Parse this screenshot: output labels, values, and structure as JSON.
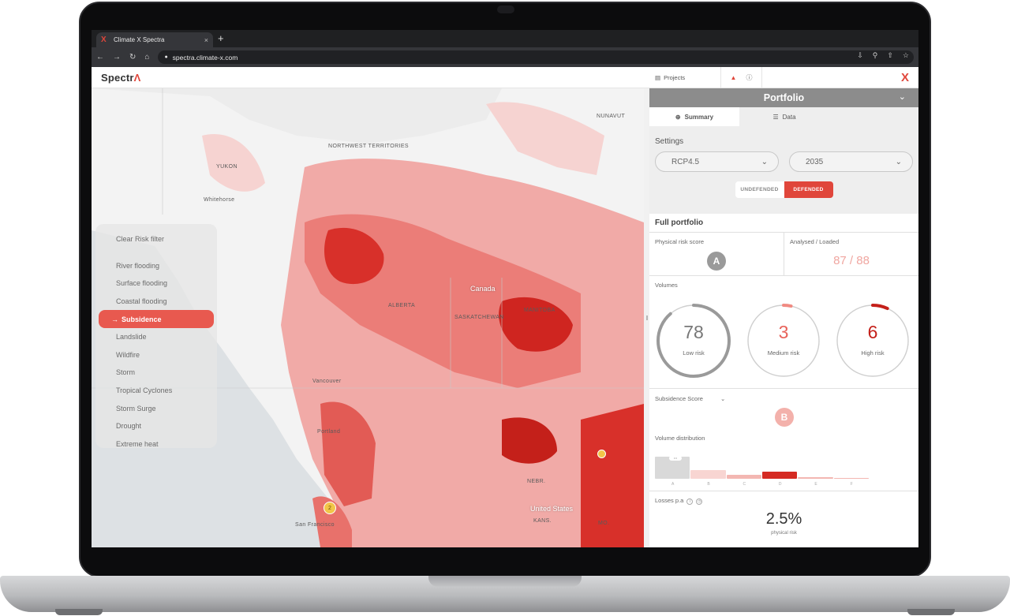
{
  "browser": {
    "tab_title": "Climate X Spectra",
    "tab_logo": "X",
    "tab_close": "×",
    "new_tab": "+",
    "url": "spectra.climate-x.com",
    "nav_icons": [
      "back-arrow",
      "forward-arrow",
      "reload",
      "home"
    ],
    "action_icons": [
      "share",
      "zoom",
      "bookmark-share",
      "star"
    ]
  },
  "app": {
    "brand_main": "Spectr",
    "brand_accent": "Λ",
    "projects_label": "Projects",
    "logo_mark": "X",
    "accent_color": "#e0463b"
  },
  "map": {
    "labels": [
      {
        "text": "NUNAVUT"
      },
      {
        "text": "NORTHWEST TERRITORIES"
      },
      {
        "text": "YUKON"
      },
      {
        "text": "Whitehorse"
      },
      {
        "text": "ALBERTA"
      },
      {
        "text": "Canada"
      },
      {
        "text": "SASKATCHEWAN"
      },
      {
        "text": "MANITOBA"
      },
      {
        "text": "Vancouver"
      },
      {
        "text": "Portland"
      },
      {
        "text": "United States"
      },
      {
        "text": "San Francisco"
      },
      {
        "text": "NEBR."
      },
      {
        "text": "KANS."
      },
      {
        "text": "MO."
      }
    ],
    "clusters": [
      {
        "label": "2"
      },
      {
        "label": ""
      }
    ]
  },
  "filters": {
    "clear_label": "Clear Risk filter",
    "items": [
      "River flooding",
      "Surface flooding",
      "Coastal flooding",
      "Subsidence",
      "Landslide",
      "Wildfire",
      "Storm",
      "Tropical Cyclones",
      "Storm Surge",
      "Drought",
      "Extreme heat"
    ],
    "active": "Subsidence",
    "active_arrow": "→"
  },
  "panel": {
    "title": "Portfolio",
    "tabs": [
      {
        "label": "Summary"
      },
      {
        "label": "Data"
      }
    ],
    "settings_title": "Settings",
    "scenario": "RCP4.5",
    "year": "2035",
    "toggle_off": "UNDEFENDED",
    "toggle_on": "DEFENDED",
    "full_title": "Full portfolio",
    "physical_risk_label": "Physical risk score",
    "physical_risk_grade": "A",
    "analysed_label": "Analysed / Loaded",
    "analysed_value": "87 / 88",
    "volumes_label": "Volumes",
    "volumes": [
      {
        "value": "78",
        "label": "Low risk",
        "fraction": 0.886,
        "color": "#9a9a9a"
      },
      {
        "value": "3",
        "label": "Medium risk",
        "fraction": 0.034,
        "color": "#f08a82"
      },
      {
        "value": "6",
        "label": "High risk",
        "fraction": 0.068,
        "color": "#c4201a"
      }
    ],
    "subsidence_label": "Subsidence Score",
    "subsidence_grade": "B",
    "volume_dist_label": "Volume distribution",
    "distribution": [
      {
        "letter": "A",
        "share": 1.0,
        "color": "#d9d9d9"
      },
      {
        "letter": "B",
        "share": 0.38,
        "color": "#f8d5d2"
      },
      {
        "letter": "C",
        "share": 0.18,
        "color": "#f3b7b2"
      },
      {
        "letter": "D",
        "share": 0.32,
        "color": "#d52a22"
      },
      {
        "letter": "E",
        "share": 0.06,
        "color": "#f3b7b2"
      },
      {
        "letter": "F",
        "share": 0.0,
        "color": "#f3b7b2"
      }
    ],
    "dist_tag": "•••",
    "losses_label": "Losses p.a",
    "losses_value": "2.5%",
    "losses_sub": "physical risk"
  }
}
